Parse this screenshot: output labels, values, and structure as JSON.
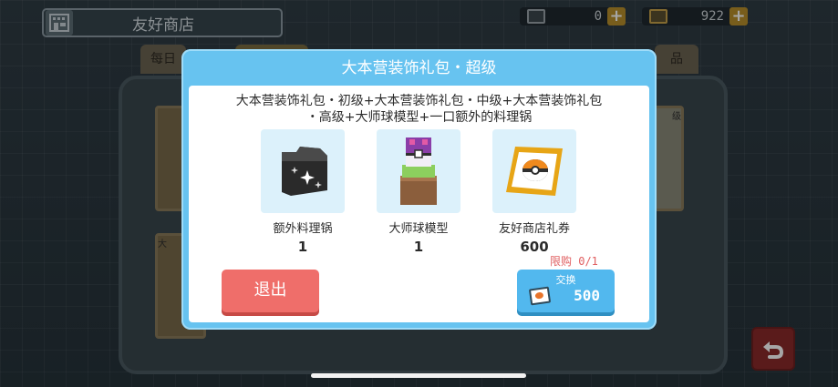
{
  "topbar": {
    "shop_title": "友好商店",
    "currency_a": {
      "icon": "ticket-icon",
      "amount": "0"
    },
    "currency_b": {
      "icon": "gold-ticket-icon",
      "amount": "922"
    }
  },
  "background_tabs": [
    {
      "label": "每日"
    },
    {
      "label": ""
    },
    {
      "label": "品"
    }
  ],
  "background_cards": [
    {
      "label": ""
    },
    {
      "label": "级"
    },
    {
      "label": "大"
    }
  ],
  "modal": {
    "title": "大本营装饰礼包・超级",
    "description_line1": "大本营装饰礼包・初级+大本营装饰礼包・中级+大本营装饰礼包",
    "description_line2": "・高级+大师球模型+一口额外的料理锅",
    "items": [
      {
        "name": "额外料理锅",
        "qty": "1",
        "icon": "cooking-pot-icon"
      },
      {
        "name": "大师球模型",
        "qty": "1",
        "icon": "master-ball-model-icon"
      },
      {
        "name": "友好商店礼券",
        "qty": "600",
        "icon": "shop-ticket-icon"
      }
    ],
    "limit_text": "限购 0/1",
    "exit_label": "退出",
    "exchange_label": "交换",
    "exchange_price": "500"
  },
  "colors": {
    "modal_blue": "#67c3f0",
    "exit_red": "#ef6e6a",
    "exchange_blue": "#52b8ee",
    "limit_red": "#e06062"
  }
}
